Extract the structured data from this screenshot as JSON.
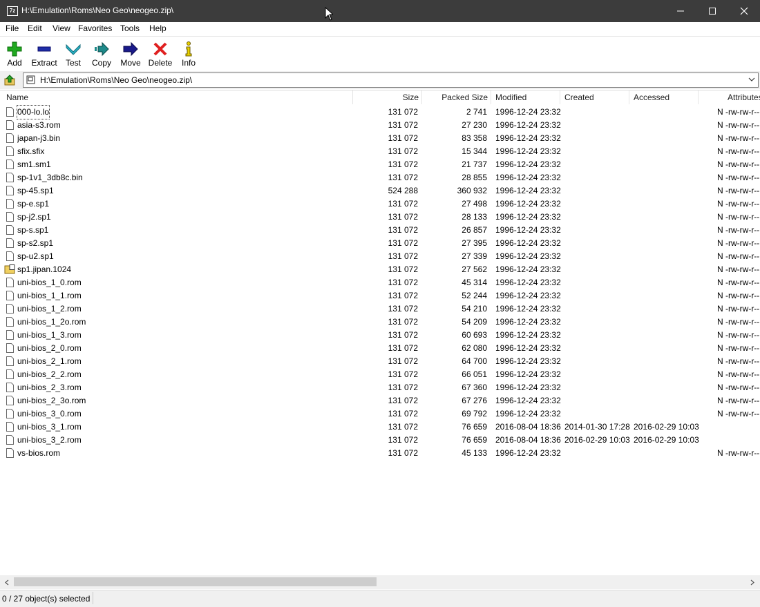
{
  "window": {
    "title": "H:\\Emulation\\Roms\\Neo Geo\\neogeo.zip\\",
    "app_icon": "7z"
  },
  "menu": [
    "File",
    "Edit",
    "View",
    "Favorites",
    "Tools",
    "Help"
  ],
  "toolbar": [
    {
      "label": "Add",
      "icon": "plus-icon",
      "color": "#1fa81f"
    },
    {
      "label": "Extract",
      "icon": "minus-icon",
      "color": "#1f2fa8"
    },
    {
      "label": "Test",
      "icon": "check-chevron-icon",
      "color": "#2bb5c8"
    },
    {
      "label": "Copy",
      "icon": "copy-arrow-icon",
      "color": "#1e8a8a"
    },
    {
      "label": "Move",
      "icon": "move-arrow-icon",
      "color": "#1a1a8a"
    },
    {
      "label": "Delete",
      "icon": "delete-x-icon",
      "color": "#e02020"
    },
    {
      "label": "Info",
      "icon": "info-icon",
      "color": "#c8b400"
    }
  ],
  "address": {
    "path": "H:\\Emulation\\Roms\\Neo Geo\\neogeo.zip\\"
  },
  "columns": [
    "Name",
    "Size",
    "Packed Size",
    "Modified",
    "Created",
    "Accessed",
    "Attributes"
  ],
  "files": [
    {
      "name": "000-lo.lo",
      "size": "131 072",
      "packed": "2 741",
      "modified": "1996-12-24 23:32",
      "created": "",
      "accessed": "",
      "attrs": "N -rw-rw-r--"
    },
    {
      "name": "asia-s3.rom",
      "size": "131 072",
      "packed": "27 230",
      "modified": "1996-12-24 23:32",
      "created": "",
      "accessed": "",
      "attrs": "N -rw-rw-r--"
    },
    {
      "name": "japan-j3.bin",
      "size": "131 072",
      "packed": "83 358",
      "modified": "1996-12-24 23:32",
      "created": "",
      "accessed": "",
      "attrs": "N -rw-rw-r--"
    },
    {
      "name": "sfix.sfix",
      "size": "131 072",
      "packed": "15 344",
      "modified": "1996-12-24 23:32",
      "created": "",
      "accessed": "",
      "attrs": "N -rw-rw-r--"
    },
    {
      "name": "sm1.sm1",
      "size": "131 072",
      "packed": "21 737",
      "modified": "1996-12-24 23:32",
      "created": "",
      "accessed": "",
      "attrs": "N -rw-rw-r--"
    },
    {
      "name": "sp-1v1_3db8c.bin",
      "size": "131 072",
      "packed": "28 855",
      "modified": "1996-12-24 23:32",
      "created": "",
      "accessed": "",
      "attrs": "N -rw-rw-r--"
    },
    {
      "name": "sp-45.sp1",
      "size": "524 288",
      "packed": "360 932",
      "modified": "1996-12-24 23:32",
      "created": "",
      "accessed": "",
      "attrs": "N -rw-rw-r--"
    },
    {
      "name": "sp-e.sp1",
      "size": "131 072",
      "packed": "27 498",
      "modified": "1996-12-24 23:32",
      "created": "",
      "accessed": "",
      "attrs": "N -rw-rw-r--"
    },
    {
      "name": "sp-j2.sp1",
      "size": "131 072",
      "packed": "28 133",
      "modified": "1996-12-24 23:32",
      "created": "",
      "accessed": "",
      "attrs": "N -rw-rw-r--"
    },
    {
      "name": "sp-s.sp1",
      "size": "131 072",
      "packed": "26 857",
      "modified": "1996-12-24 23:32",
      "created": "",
      "accessed": "",
      "attrs": "N -rw-rw-r--"
    },
    {
      "name": "sp-s2.sp1",
      "size": "131 072",
      "packed": "27 395",
      "modified": "1996-12-24 23:32",
      "created": "",
      "accessed": "",
      "attrs": "N -rw-rw-r--"
    },
    {
      "name": "sp-u2.sp1",
      "size": "131 072",
      "packed": "27 339",
      "modified": "1996-12-24 23:32",
      "created": "",
      "accessed": "",
      "attrs": "N -rw-rw-r--"
    },
    {
      "name": "sp1.jipan.1024",
      "size": "131 072",
      "packed": "27 562",
      "modified": "1996-12-24 23:32",
      "created": "",
      "accessed": "",
      "attrs": "N -rw-rw-r--",
      "special": true
    },
    {
      "name": "uni-bios_1_0.rom",
      "size": "131 072",
      "packed": "45 314",
      "modified": "1996-12-24 23:32",
      "created": "",
      "accessed": "",
      "attrs": "N -rw-rw-r--"
    },
    {
      "name": "uni-bios_1_1.rom",
      "size": "131 072",
      "packed": "52 244",
      "modified": "1996-12-24 23:32",
      "created": "",
      "accessed": "",
      "attrs": "N -rw-rw-r--"
    },
    {
      "name": "uni-bios_1_2.rom",
      "size": "131 072",
      "packed": "54 210",
      "modified": "1996-12-24 23:32",
      "created": "",
      "accessed": "",
      "attrs": "N -rw-rw-r--"
    },
    {
      "name": "uni-bios_1_2o.rom",
      "size": "131 072",
      "packed": "54 209",
      "modified": "1996-12-24 23:32",
      "created": "",
      "accessed": "",
      "attrs": "N -rw-rw-r--"
    },
    {
      "name": "uni-bios_1_3.rom",
      "size": "131 072",
      "packed": "60 693",
      "modified": "1996-12-24 23:32",
      "created": "",
      "accessed": "",
      "attrs": "N -rw-rw-r--"
    },
    {
      "name": "uni-bios_2_0.rom",
      "size": "131 072",
      "packed": "62 080",
      "modified": "1996-12-24 23:32",
      "created": "",
      "accessed": "",
      "attrs": "N -rw-rw-r--"
    },
    {
      "name": "uni-bios_2_1.rom",
      "size": "131 072",
      "packed": "64 700",
      "modified": "1996-12-24 23:32",
      "created": "",
      "accessed": "",
      "attrs": "N -rw-rw-r--"
    },
    {
      "name": "uni-bios_2_2.rom",
      "size": "131 072",
      "packed": "66 051",
      "modified": "1996-12-24 23:32",
      "created": "",
      "accessed": "",
      "attrs": "N -rw-rw-r--"
    },
    {
      "name": "uni-bios_2_3.rom",
      "size": "131 072",
      "packed": "67 360",
      "modified": "1996-12-24 23:32",
      "created": "",
      "accessed": "",
      "attrs": "N -rw-rw-r--"
    },
    {
      "name": "uni-bios_2_3o.rom",
      "size": "131 072",
      "packed": "67 276",
      "modified": "1996-12-24 23:32",
      "created": "",
      "accessed": "",
      "attrs": "N -rw-rw-r--"
    },
    {
      "name": "uni-bios_3_0.rom",
      "size": "131 072",
      "packed": "69 792",
      "modified": "1996-12-24 23:32",
      "created": "",
      "accessed": "",
      "attrs": "N -rw-rw-r--"
    },
    {
      "name": "uni-bios_3_1.rom",
      "size": "131 072",
      "packed": "76 659",
      "modified": "2016-08-04 18:36",
      "created": "2014-01-30 17:28",
      "accessed": "2016-02-29 10:03",
      "attrs": ""
    },
    {
      "name": "uni-bios_3_2.rom",
      "size": "131 072",
      "packed": "76 659",
      "modified": "2016-08-04 18:36",
      "created": "2016-02-29 10:03",
      "accessed": "2016-02-29 10:03",
      "attrs": ""
    },
    {
      "name": "vs-bios.rom",
      "size": "131 072",
      "packed": "45 133",
      "modified": "1996-12-24 23:32",
      "created": "",
      "accessed": "",
      "attrs": "N -rw-rw-r--"
    }
  ],
  "status": {
    "text": "0 / 27 object(s) selected"
  }
}
